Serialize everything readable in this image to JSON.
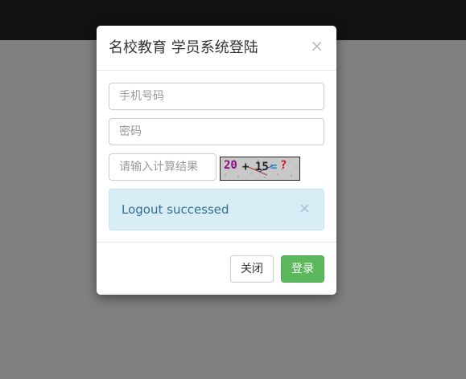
{
  "modal": {
    "title": "名校教育 学员系统登陆",
    "close_glyph": "×"
  },
  "form": {
    "phone_placeholder": "手机号码",
    "password_placeholder": "密码",
    "captcha_placeholder": "请输入计算结果",
    "captcha_text": "20 + 15 = ?"
  },
  "alert": {
    "message": "Logout successed",
    "close_glyph": "×"
  },
  "footer": {
    "close_label": "关闭",
    "login_label": "登录"
  },
  "colors": {
    "topbar": "#111111",
    "backdrop": "#808080",
    "alert_bg": "#d9edf7",
    "alert_text": "#31708f",
    "login_button": "#5cb85c"
  }
}
